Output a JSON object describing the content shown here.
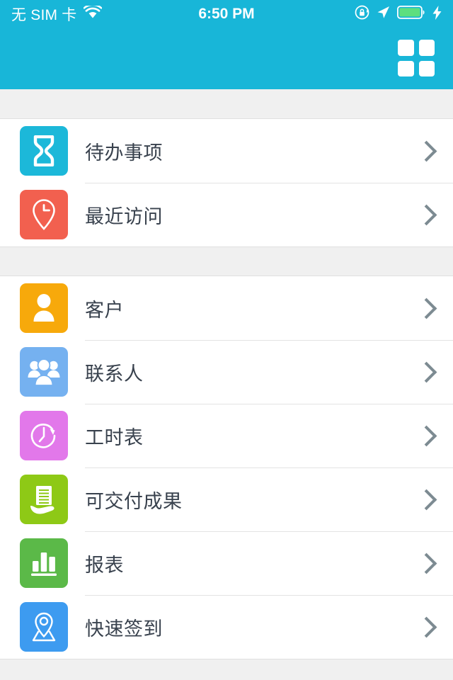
{
  "status_bar": {
    "carrier": "无 SIM 卡",
    "wifi_icon": "wifi-icon",
    "time": "6:50 PM",
    "rotation_lock_icon": "rotation-lock-icon",
    "location_icon": "location-arrow-icon",
    "battery_icon": "battery-full-icon",
    "charging_icon": "charging-bolt-icon",
    "battery_color": "#5ddf7f"
  },
  "header": {
    "background_color": "#18b6d8",
    "grid_button": "grid-menu-button"
  },
  "sections": [
    {
      "id": "section-tasks",
      "items": [
        {
          "label": "待办事项",
          "icon": "hourglass-icon",
          "color": "#1cb8d9"
        },
        {
          "label": "最近访问",
          "icon": "pin-clock-icon",
          "color": "#f2604f"
        }
      ]
    },
    {
      "id": "section-modules",
      "items": [
        {
          "label": "客户",
          "icon": "person-icon",
          "color": "#f7a90b"
        },
        {
          "label": "联系人",
          "icon": "people-group-icon",
          "color": "#75b1f0"
        },
        {
          "label": "工时表",
          "icon": "clock-refresh-icon",
          "color": "#e278ea"
        },
        {
          "label": "可交付成果",
          "icon": "document-hand-icon",
          "color": "#8ec916"
        },
        {
          "label": "报表",
          "icon": "bar-chart-icon",
          "color": "#5bb948"
        },
        {
          "label": "快速签到",
          "icon": "pin-map-icon",
          "color": "#3d9bf0"
        }
      ]
    }
  ],
  "chevron_icon": "chevron-right-icon"
}
